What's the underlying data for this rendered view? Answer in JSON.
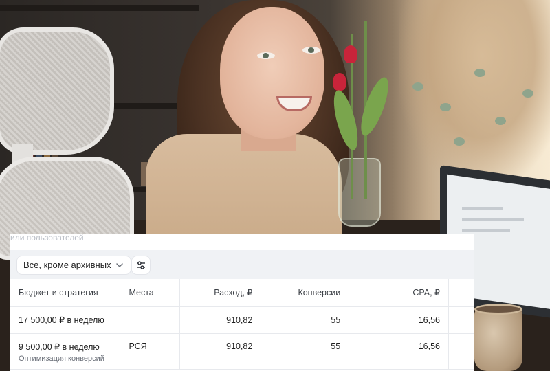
{
  "ui": {
    "hint_text": "или пользователей",
    "status_filter": {
      "selected": "Все, кроме архивных"
    },
    "filters_button": {
      "icon": "sliders-icon"
    },
    "table": {
      "columns": [
        "Бюджет и стратегия",
        "Места",
        "Расход, ₽",
        "Конверсии",
        "CPA, ₽"
      ],
      "rows": [
        {
          "budget": "17 500,00 ₽ в неделю",
          "strategy": "",
          "placements": "",
          "spend": "910,82",
          "conversions": "55",
          "cpa": "16,56"
        },
        {
          "budget": "9 500,00 ₽ в неделю",
          "strategy": "Оптимизация конверсий",
          "placements": "РСЯ",
          "spend": "910,82",
          "conversions": "55",
          "cpa": "16,56"
        }
      ]
    }
  }
}
